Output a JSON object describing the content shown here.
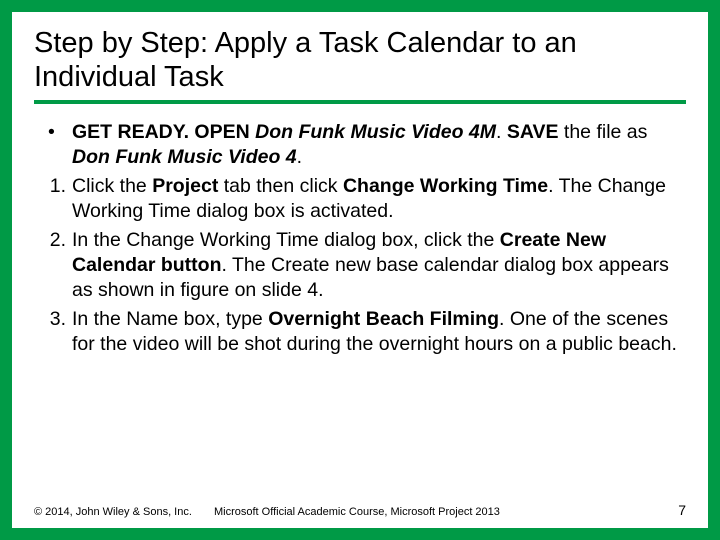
{
  "title": "Step by Step: Apply a Task Calendar to an Individual Task",
  "bullet": {
    "r1": "GET READY. OPEN ",
    "r2": "Don Funk Music Video 4M",
    "r3": ". ",
    "r4": "SAVE ",
    "r5": "the file as ",
    "r6": "Don Funk Music Video 4",
    "r7": "."
  },
  "steps": [
    {
      "num": "1.",
      "r1": "Click the ",
      "r2": "Project ",
      "r3": "tab then click ",
      "r4": "Change Working Time",
      "r5": ". The Change Working Time dialog box is activated."
    },
    {
      "num": "2.",
      "r1": "In the Change Working Time dialog box, click the ",
      "r2": "Create New Calendar button",
      "r3": ". The Create new base calendar dialog box appears as shown in figure on slide 4."
    },
    {
      "num": "3.",
      "r1": "In the Name box, type ",
      "r2": "Overnight Beach Filming",
      "r3": ". One of the scenes for the video will be shot during the overnight hours on a public beach."
    }
  ],
  "footer": {
    "left": "© 2014, John Wiley & Sons, Inc.",
    "center": "Microsoft Official Academic Course, Microsoft Project 2013",
    "right": "7"
  }
}
